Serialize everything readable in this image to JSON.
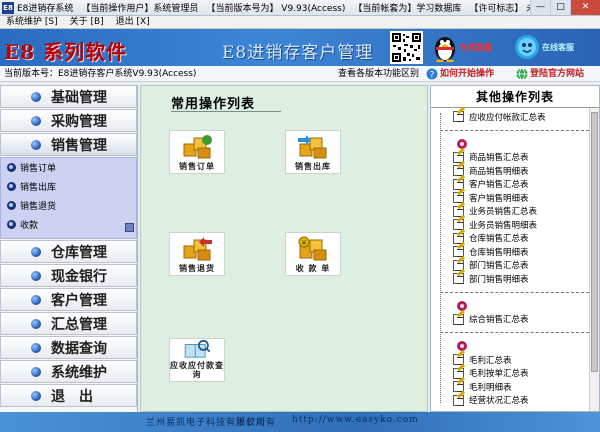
{
  "titlebar": {
    "app": "E8进销存系统",
    "operator": "【当前操作用户】系统管理员",
    "version": "【当前版本号为】 V9.93(Access)",
    "account": "【当前帐套为】学习数据库",
    "license": "【许可标志】 未注册版",
    "min": "—",
    "max": "□",
    "close": "✕"
  },
  "menu": [
    "系统维护 [S]",
    "关于 [B]",
    "退出 [X]"
  ],
  "banner": {
    "logo": "E8 系列软件",
    "title": "E8进销存客户管理",
    "qq1_label": "在线客服",
    "qq2_label": "在线客服"
  },
  "infobar": {
    "version": "当前版本号：E8进销存客户系统V9.93(Access)",
    "features": "查看各版本功能区别",
    "howto": "如何开始操作",
    "login": "登陆官方网站"
  },
  "sidebar": {
    "items": [
      {
        "label": "基础管理"
      },
      {
        "label": "采购管理"
      },
      {
        "label": "销售管理"
      },
      {
        "label": "仓库管理"
      },
      {
        "label": "现金银行"
      },
      {
        "label": "客户管理"
      },
      {
        "label": "汇总管理"
      },
      {
        "label": "数据查询"
      },
      {
        "label": "系统维护"
      },
      {
        "label": "退　出"
      }
    ],
    "sub_items": [
      "销售订单",
      "销售出库",
      "销售退货",
      "收款"
    ]
  },
  "center": {
    "header": "常用操作列表",
    "tiles": [
      {
        "label": "销售订单"
      },
      {
        "label": "销售出库"
      },
      {
        "label": "销售退货"
      },
      {
        "label": "收 款 单"
      },
      {
        "label": "应收应付款查询"
      }
    ]
  },
  "right": {
    "header": "其他操作列表",
    "items": [
      "应收应付帐款汇总表",
      "商品销售汇总表",
      "商品销售明细表",
      "客户销售汇总表",
      "客户销售明细表",
      "业务员销售汇总表",
      "业务员销售明细表",
      "仓库销售汇总表",
      "仓库销售明细表",
      "部门销售汇总表",
      "部门销售明细表",
      "综合销售汇总表",
      "毛利汇总表",
      "毛利按单汇总表",
      "毛利明细表",
      "经营状况汇总表"
    ]
  },
  "footer": {
    "company": "兰州易凯电子科技有限公司",
    "rights": "版权所有",
    "url": "http://www.easyko.com"
  },
  "colors": {
    "banner": "#2a6cc0",
    "logo_red": "#b80000",
    "center_bg": "#dcefe1",
    "submenu_bg": "#cdd1f2",
    "footer": "#2e6fb8"
  }
}
